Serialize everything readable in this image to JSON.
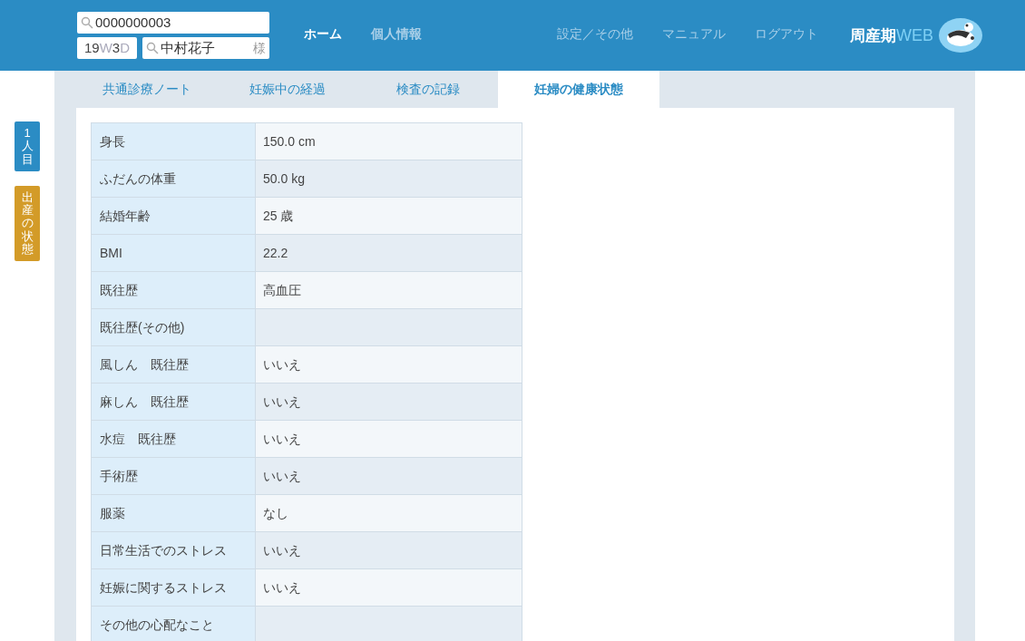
{
  "header": {
    "id_search": {
      "value": "0000000003"
    },
    "gestation": {
      "weeks": "19",
      "week_unit": "W",
      "days": "3",
      "day_unit": "D"
    },
    "name_search": {
      "value": "中村花子",
      "suffix": "様"
    },
    "nav": [
      {
        "label": "ホーム",
        "selected": true
      },
      {
        "label": "個人情報",
        "selected": false
      }
    ],
    "right_nav": [
      "設定／その他",
      "マニュアル",
      "ログアウト"
    ],
    "logo": {
      "text": "周産期",
      "accent": "WEB"
    }
  },
  "side_tabs": [
    {
      "label": "1人目",
      "color": "#2b8cc4"
    },
    {
      "label": "出産の状態",
      "color": "#d39b28"
    }
  ],
  "tabs": [
    {
      "label": "共通診療ノート",
      "selected": false
    },
    {
      "label": "妊娠中の経過",
      "selected": false
    },
    {
      "label": "検査の記録",
      "selected": false
    },
    {
      "label": "妊婦の健康状態",
      "selected": true
    }
  ],
  "table": {
    "rows": [
      {
        "label": "身長",
        "value": "150.0 cm"
      },
      {
        "label": "ふだんの体重",
        "value": "50.0 kg"
      },
      {
        "label": "結婚年齢",
        "value": "25 歳"
      },
      {
        "label": "BMI",
        "value": "22.2"
      },
      {
        "label": "既往歴",
        "value": "高血圧"
      },
      {
        "label": "既往歴(その他)",
        "value": ""
      },
      {
        "label": "風しん　既往歴",
        "value": "いいえ"
      },
      {
        "label": "麻しん　既往歴",
        "value": "いいえ"
      },
      {
        "label": "水痘　既往歴",
        "value": "いいえ"
      },
      {
        "label": "手術歴",
        "value": "いいえ"
      },
      {
        "label": "服薬",
        "value": "なし"
      },
      {
        "label": "日常生活でのストレス",
        "value": "いいえ"
      },
      {
        "label": "妊娠に関するストレス",
        "value": "いいえ"
      },
      {
        "label": "その他の心配なこと",
        "value": ""
      }
    ]
  }
}
